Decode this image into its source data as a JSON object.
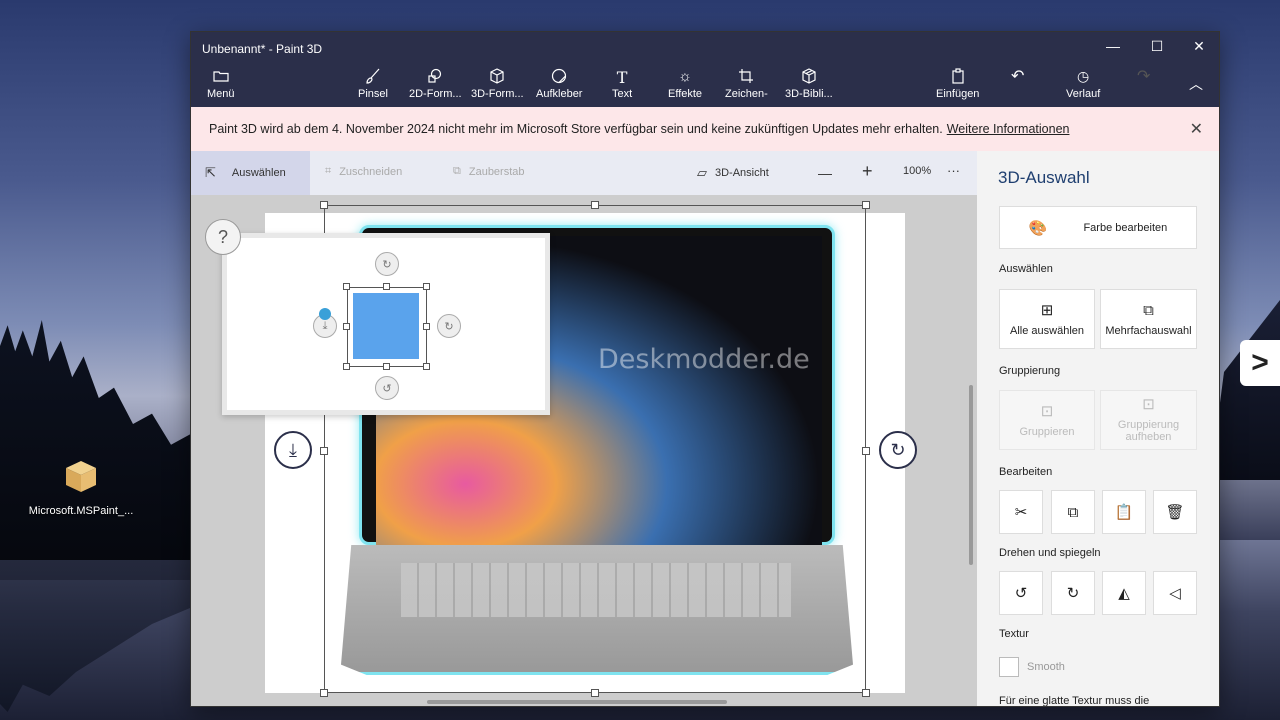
{
  "desktop": {
    "icon_label": "Microsoft.MSPaint_..."
  },
  "window": {
    "title": "Unbenannt* - Paint 3D",
    "controls": {
      "minimize": "—",
      "maximize": "☐",
      "close": "✕"
    }
  },
  "toolbar": {
    "menu": "Menü",
    "brushes": "Pinsel",
    "shapes2d": "2D-Form...",
    "shapes3d": "3D-Form...",
    "stickers": "Aufkleber",
    "text": "Text",
    "effects": "Effekte",
    "canvas": "Zeichen-",
    "library3d": "3D-Bibli...",
    "paste": "Einfügen",
    "history": "Verlauf"
  },
  "banner": {
    "message": "Paint 3D wird ab dem 4. November 2024 nicht mehr im Microsoft Store verfügbar sein und keine zukünftigen Updates mehr erhalten.",
    "link": "Weitere Informationen",
    "close": "✕"
  },
  "subbar": {
    "select": "Auswählen",
    "crop": "Zuschneiden",
    "magic_select": "Zauberstab",
    "view3d": "3D-Ansicht",
    "zoom_out": "—",
    "zoom_in": "+",
    "zoom": "100%",
    "more": "···"
  },
  "canvas": {
    "watermark": "Deskmodder.de",
    "help": "?"
  },
  "sidebar": {
    "title": "3D-Auswahl",
    "edit_color": "Farbe bearbeiten",
    "select_heading": "Auswählen",
    "select_all": "Alle auswählen",
    "multi_select": "Mehrfachauswahl",
    "group_heading": "Gruppierung",
    "group": "Gruppieren",
    "ungroup": "Gruppierung aufheben",
    "edit_heading": "Bearbeiten",
    "rotate_heading": "Drehen und spiegeln",
    "texture_heading": "Textur",
    "smooth": "Smooth",
    "smooth_note": "Für eine glatte Textur muss die"
  },
  "next_button": ">"
}
